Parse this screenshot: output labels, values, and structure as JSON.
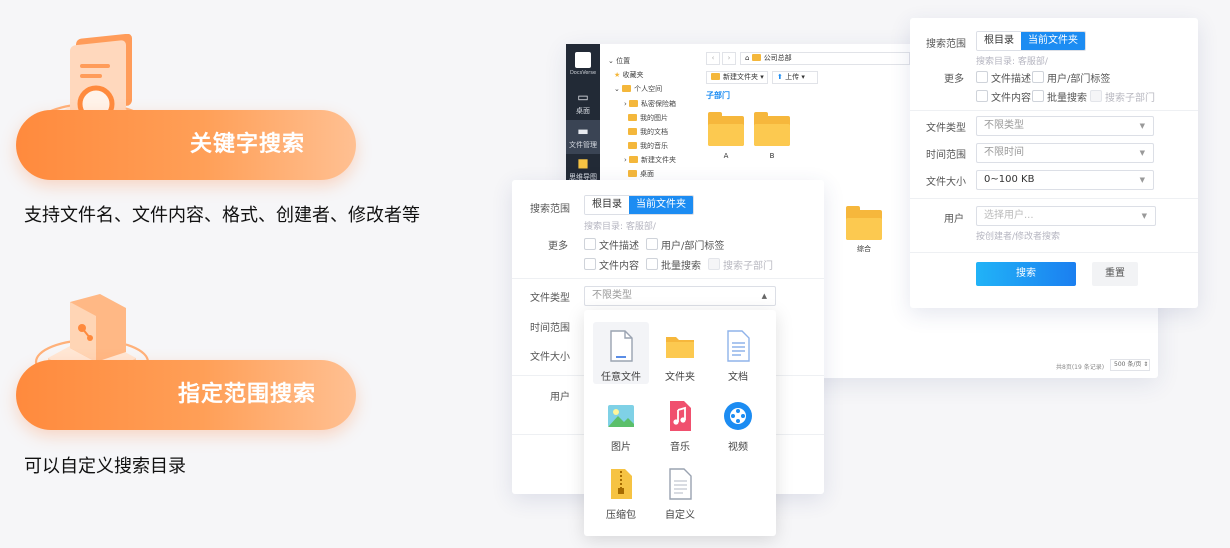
{
  "promo": {
    "feature1_title": "关键字搜索",
    "feature1_desc": "支持文件名、文件内容、格式、创建者、修改者等",
    "feature2_title": "指定范围搜索",
    "feature2_desc": "可以自定义搜索目录"
  },
  "file_manager": {
    "logo_text": "DocsVerse",
    "nav": [
      {
        "label": "桌面",
        "icon": "desktop-icon"
      },
      {
        "label": "文件管理",
        "icon": "folder-icon"
      },
      {
        "label": "思维导图",
        "icon": "mindmap-icon"
      }
    ],
    "tree": {
      "root": "位置",
      "favorites": "收藏夹",
      "personal": "个人空间",
      "children": [
        "私密保险箱",
        "我的图片",
        "我的文档",
        "我的音乐",
        "新建文件夹",
        "桌面"
      ]
    },
    "breadcrumb": "公司总部",
    "toolbar": {
      "new_folder": "新建文件夹",
      "upload": "上传"
    },
    "section": "子部门",
    "folders": [
      "A",
      "B"
    ],
    "folder_extra": "综合",
    "footer": {
      "total": "共8页(19 条记录)",
      "page_size": "500 条/页"
    }
  },
  "search_panel": {
    "scope_label": "搜索范围",
    "scope_tabs": [
      "根目录",
      "当前文件夹"
    ],
    "scope_active": 1,
    "scope_hint": "搜索目录: 客服部/",
    "more_label": "更多",
    "options": [
      "文件描述",
      "用户/部门标签",
      "文件内容",
      "批量搜索",
      "搜索子部门"
    ],
    "type_label": "文件类型",
    "type_value": "不限类型",
    "time_label": "时间范围",
    "time_value": "不限时间",
    "size_label": "文件大小",
    "size_value": "0~100 KB",
    "user_label": "用户",
    "user_placeholder": "选择用户...",
    "user_hint": "按创建者/修改者搜索",
    "search_button": "搜索",
    "reset_button": "重置"
  },
  "type_dropdown": {
    "items": [
      {
        "label": "任意文件",
        "icon": "any-file-icon"
      },
      {
        "label": "文件夹",
        "icon": "folder-icon"
      },
      {
        "label": "文档",
        "icon": "document-icon"
      },
      {
        "label": "图片",
        "icon": "image-icon"
      },
      {
        "label": "音乐",
        "icon": "music-icon"
      },
      {
        "label": "视频",
        "icon": "video-icon"
      },
      {
        "label": "压缩包",
        "icon": "zip-icon"
      },
      {
        "label": "自定义",
        "icon": "custom-file-icon"
      }
    ],
    "selected": 0
  },
  "colors": {
    "accent_orange": "#ff8a3d",
    "primary_blue": "#1c8cf2",
    "sidebar_dark": "#222a36",
    "folder_yellow": "#f6b73c"
  }
}
